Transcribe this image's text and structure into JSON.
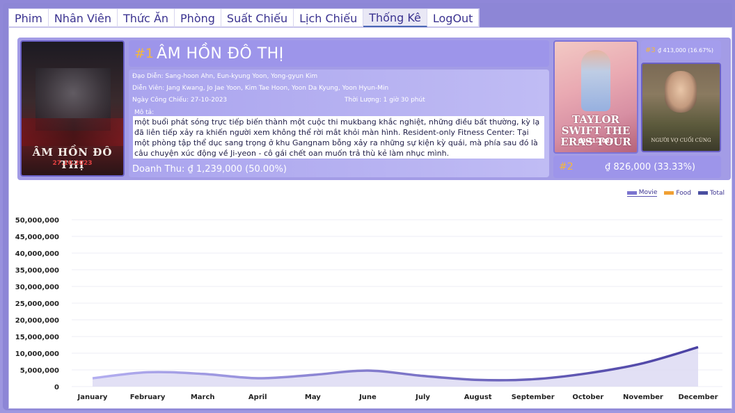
{
  "tabs": [
    "Phim",
    "Nhân Viên",
    "Thức Ăn",
    "Phòng",
    "Suất Chiếu",
    "Lịch Chiếu",
    "Thống Kê",
    "LogOut"
  ],
  "active_tab": "Thống Kê",
  "top1": {
    "rank": "#1",
    "title": "ÂM HỒN ĐÔ THỊ",
    "poster_title": "ÂM HỒN ĐÔ THỊ",
    "poster_date": "27.10.2023",
    "director_line": "Đạo Diễn: Sang-hoon Ahn, Eun-kyung Yoon, Yong-gyun Kim",
    "cast_line": "Diễn Viên: Jang Kwang, Jo Jae Yoon, Kim Tae Hoon, Yoon Da Kyung, Yoon Hyun-Min",
    "release_line": "Ngày Công Chiếu: 27-10-2023",
    "duration_line": "Thời Lượng: 1 giờ 30 phút",
    "desc_label": "Mô tả:",
    "description": "một buổi phát sóng trực tiếp biến thành một cuộc thi mukbang khắc nghiệt, những điều bất thường, kỳ lạ đã liên tiếp xảy ra khiến người xem không thể rời mắt khỏi màn hình. Resident-only Fitness Center: Tại một phòng tập thể dục sang trọng ở khu Gangnam bỗng xảy ra những sự kiện kỳ quái, mà phía sau đó là câu chuyện xúc động về Ji-yeon - cô gái chết oan muốn trả thù kẻ làm nhục mình.",
    "revenue_label": "Doanh Thu:",
    "revenue_value": "₫ 1,239,000 (50.00%)"
  },
  "top2": {
    "rank": "#2",
    "revenue": "₫ 826,000 (33.33%)",
    "poster_title": "TAYLOR SWIFT THE ERAS TOUR",
    "poster_date": "03.11.2023"
  },
  "top3": {
    "rank": "#3",
    "revenue": "₫ 413,000 (16.67%)",
    "poster_title": "NGƯỜI VỢ CUỐI CÙNG"
  },
  "legend": [
    {
      "name": "Movie",
      "color": "#7a73cf",
      "active": true
    },
    {
      "name": "Food",
      "color": "#f0a033",
      "active": false
    },
    {
      "name": "Total",
      "color": "#4a4fa0",
      "active": false
    }
  ],
  "chart_data": {
    "type": "area",
    "categories": [
      "January",
      "February",
      "March",
      "April",
      "May",
      "June",
      "July",
      "August",
      "September",
      "October",
      "November",
      "December"
    ],
    "series": [
      {
        "name": "Movie",
        "values": [
          2500000,
          4300000,
          3800000,
          2500000,
          3500000,
          4800000,
          3200000,
          2000000,
          2200000,
          4000000,
          7000000,
          11800000
        ]
      }
    ],
    "yticks": [
      "0",
      "5,000,000",
      "10,000,000",
      "15,000,000",
      "20,000,000",
      "25,000,000",
      "30,000,000",
      "35,000,000",
      "40,000,000",
      "45,000,000",
      "50,000,000"
    ],
    "ylim": [
      0,
      50000000
    ],
    "grid": true,
    "legend_position": "top-right"
  }
}
